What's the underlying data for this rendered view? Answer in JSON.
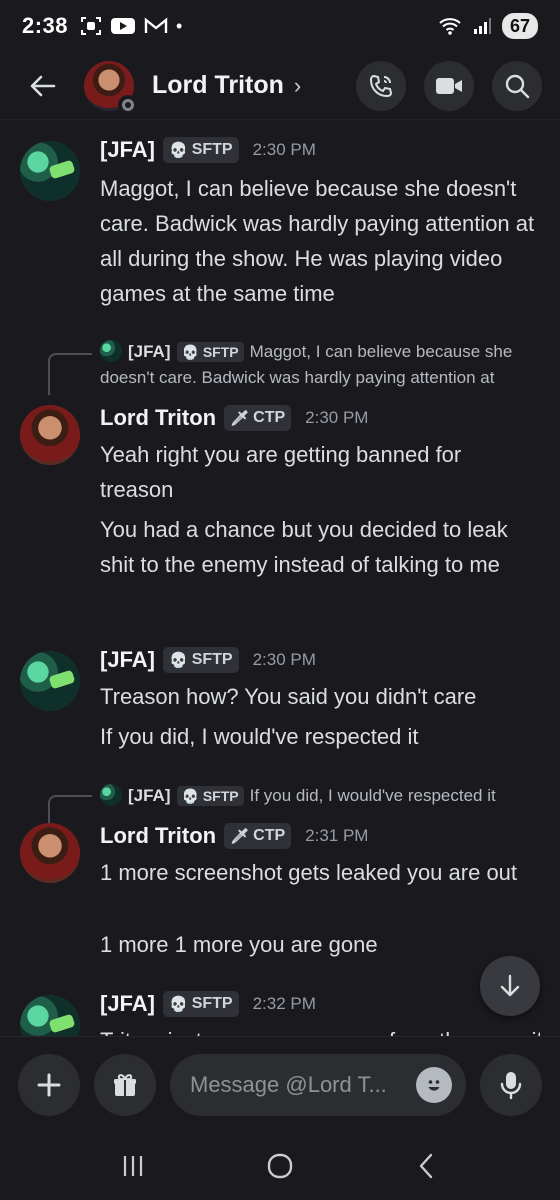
{
  "status_bar": {
    "time": "2:38",
    "battery": "67",
    "dot": "•"
  },
  "header": {
    "contact_name": "Lord Triton",
    "chevron": "›"
  },
  "messages": [
    {
      "author": "[JFA]",
      "tag": "SFTP",
      "tag_icon": "skull-icon",
      "time": "2:30 PM",
      "lines": [
        "Maggot, I can believe because she doesn't care. Badwick was hardly paying attention at all during the show. He was playing video games at the same time"
      ]
    },
    {
      "reply": {
        "author": "[JFA]",
        "tag": "SFTP",
        "text": "Maggot, I can believe because she doesn't care. Badwick was hardly paying attention at"
      },
      "author": "Lord Triton",
      "tag": "CTP",
      "tag_icon": "sword-icon",
      "time": "2:30 PM",
      "lines": [
        "Yeah right you are getting banned for treason",
        "You had a chance but you decided to leak shit to the enemy instead of talking to me"
      ]
    },
    {
      "author": "[JFA]",
      "tag": "SFTP",
      "tag_icon": "skull-icon",
      "time": "2:30 PM",
      "lines": [
        "Treason how? You said you didn't care",
        "If you did, I would've respected it"
      ]
    },
    {
      "reply": {
        "author": "[JFA]",
        "tag": "SFTP",
        "text": "If you did, I would've respected it"
      },
      "author": "Lord Triton",
      "tag": "CTP",
      "tag_icon": "sword-icon",
      "time": "2:31 PM",
      "lines": [
        "1 more screenshot gets leaked you are out",
        "1 more 1 more you are gone"
      ]
    },
    {
      "author": "[JFA]",
      "tag": "SFTP",
      "tag_icon": "skull-icon",
      "time": "2:32 PM",
      "lines": [
        "Triton, just so you are aware, from the way...if"
      ]
    }
  ],
  "composer": {
    "placeholder": "Message @Lord T..."
  },
  "colors": {
    "background": "#1a1a1e",
    "surface": "#2b2d31",
    "text": "#dbdee1",
    "muted": "#949ba4",
    "offline_status": "#80848e"
  }
}
